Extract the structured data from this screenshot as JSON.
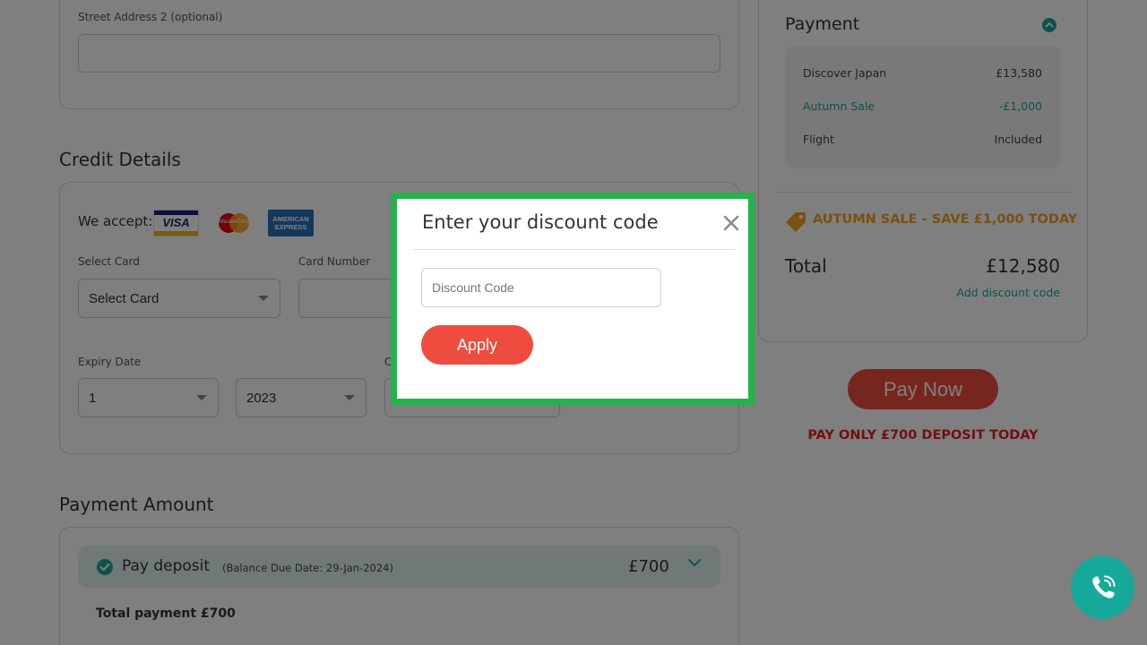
{
  "address": {
    "street2_label": "Street Address 2 (optional)",
    "street2_value": ""
  },
  "credit": {
    "title": "Credit Details",
    "we_accept": "We accept:",
    "card_logos": [
      {
        "name": "visa",
        "text": "VISA"
      },
      {
        "name": "mastercard",
        "text": "MasterCard"
      },
      {
        "name": "amex",
        "text": "AMERICAN EXPRESS"
      }
    ],
    "select_card_label": "Select Card",
    "select_card_value": "Select Card",
    "card_number_label": "Card Number",
    "card_number_value": "",
    "expiry_label": "Expiry Date",
    "expiry_month": "1",
    "expiry_year": "2023",
    "cvv_label_partial": "C"
  },
  "payment_amount": {
    "title": "Payment Amount",
    "option_label": "Pay deposit",
    "balance_note": "(Balance Due Date: 29-Jan-2024)",
    "option_amount": "£700",
    "total_label": "Total payment £700"
  },
  "summary": {
    "title": "Payment",
    "rows": [
      {
        "label": "Discover Japan",
        "value": "£13,580"
      },
      {
        "label": "Autumn Sale",
        "value": "-£1,000"
      },
      {
        "label": "Flight",
        "value": "Included"
      }
    ],
    "promo_text": "AUTUMN SALE - SAVE £1,000 TODAY",
    "total_label": "Total",
    "total_value": "£12,580",
    "add_discount_link": "Add discount code",
    "pay_now": "Pay Now",
    "deposit_note": "PAY ONLY £700 DEPOSIT TODAY"
  },
  "modal": {
    "title": "Enter your discount code",
    "input_placeholder": "Discount Code",
    "input_value": "",
    "apply_label": "Apply"
  },
  "colors": {
    "accent_teal": "#16a99a",
    "cta_red": "#ee4c3f",
    "modal_border": "#22b34a",
    "promo_orange": "#f0a22a"
  },
  "icons": {
    "close": "close-icon",
    "collapse": "chevron-up-icon",
    "expand": "chevron-down-icon",
    "check": "check-circle-icon",
    "tag": "sale-tag-icon",
    "phone": "phone-call-icon"
  }
}
